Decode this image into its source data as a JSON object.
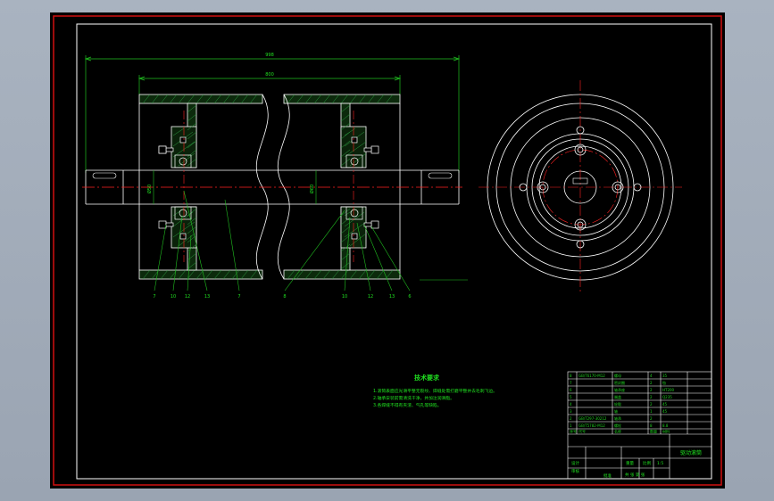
{
  "colors": {
    "frame": "#ffffff",
    "outer_frame": "#d01010",
    "part": "#ffffff",
    "hatch": "#2ea043",
    "center": "#ff2020",
    "dimension": "#20c020",
    "leader": "#20c020",
    "text": "#20e020",
    "table_text": "#20d020",
    "background": "#000000"
  },
  "dimensions": {
    "overall_length": "998",
    "drum_length": "800",
    "small_dia": "Ø50",
    "shaft_dia": "Ø60"
  },
  "balloons": [
    "7",
    "10",
    "12",
    "13",
    "7",
    "8",
    "10",
    "12",
    "13",
    "6"
  ],
  "notes": {
    "title": "技术要求",
    "items": [
      "1.滚筒表面应光滑平整无裂纹、焊缝处需打磨平整并去毛刺飞边。",
      "2.轴承安装前需清洗干净，并加注润滑脂。",
      "3.各焊缝不得有夹渣、气孔等缺陷。"
    ]
  },
  "title_block": {
    "drawing_title": "驱动滚筒",
    "scale": "1:5",
    "bom_rows": [
      [
        "8",
        "GB/T6170-M12",
        "螺母",
        "4",
        "35"
      ],
      [
        "7",
        "",
        "密封圈",
        "2",
        "毡"
      ],
      [
        "6",
        "",
        "轴承座",
        "2",
        "HT200"
      ],
      [
        "5",
        "",
        "端盖",
        "2",
        "Q235"
      ],
      [
        "4",
        "",
        "轮毂",
        "2",
        "45"
      ],
      [
        "3",
        "",
        "轴",
        "1",
        "45"
      ],
      [
        "2",
        "GB/T297-30212",
        "轴承",
        "2",
        ""
      ],
      [
        "1",
        "GB/T5782-M12",
        "螺栓",
        "8",
        "8.8"
      ]
    ],
    "header": [
      "序号",
      "代号",
      "名称",
      "数量",
      "材料"
    ],
    "design": "设计",
    "check": "审核",
    "approve": "批准",
    "weight_label": "重量",
    "scale_label": "比例",
    "sheet": "共 张 第 张"
  }
}
